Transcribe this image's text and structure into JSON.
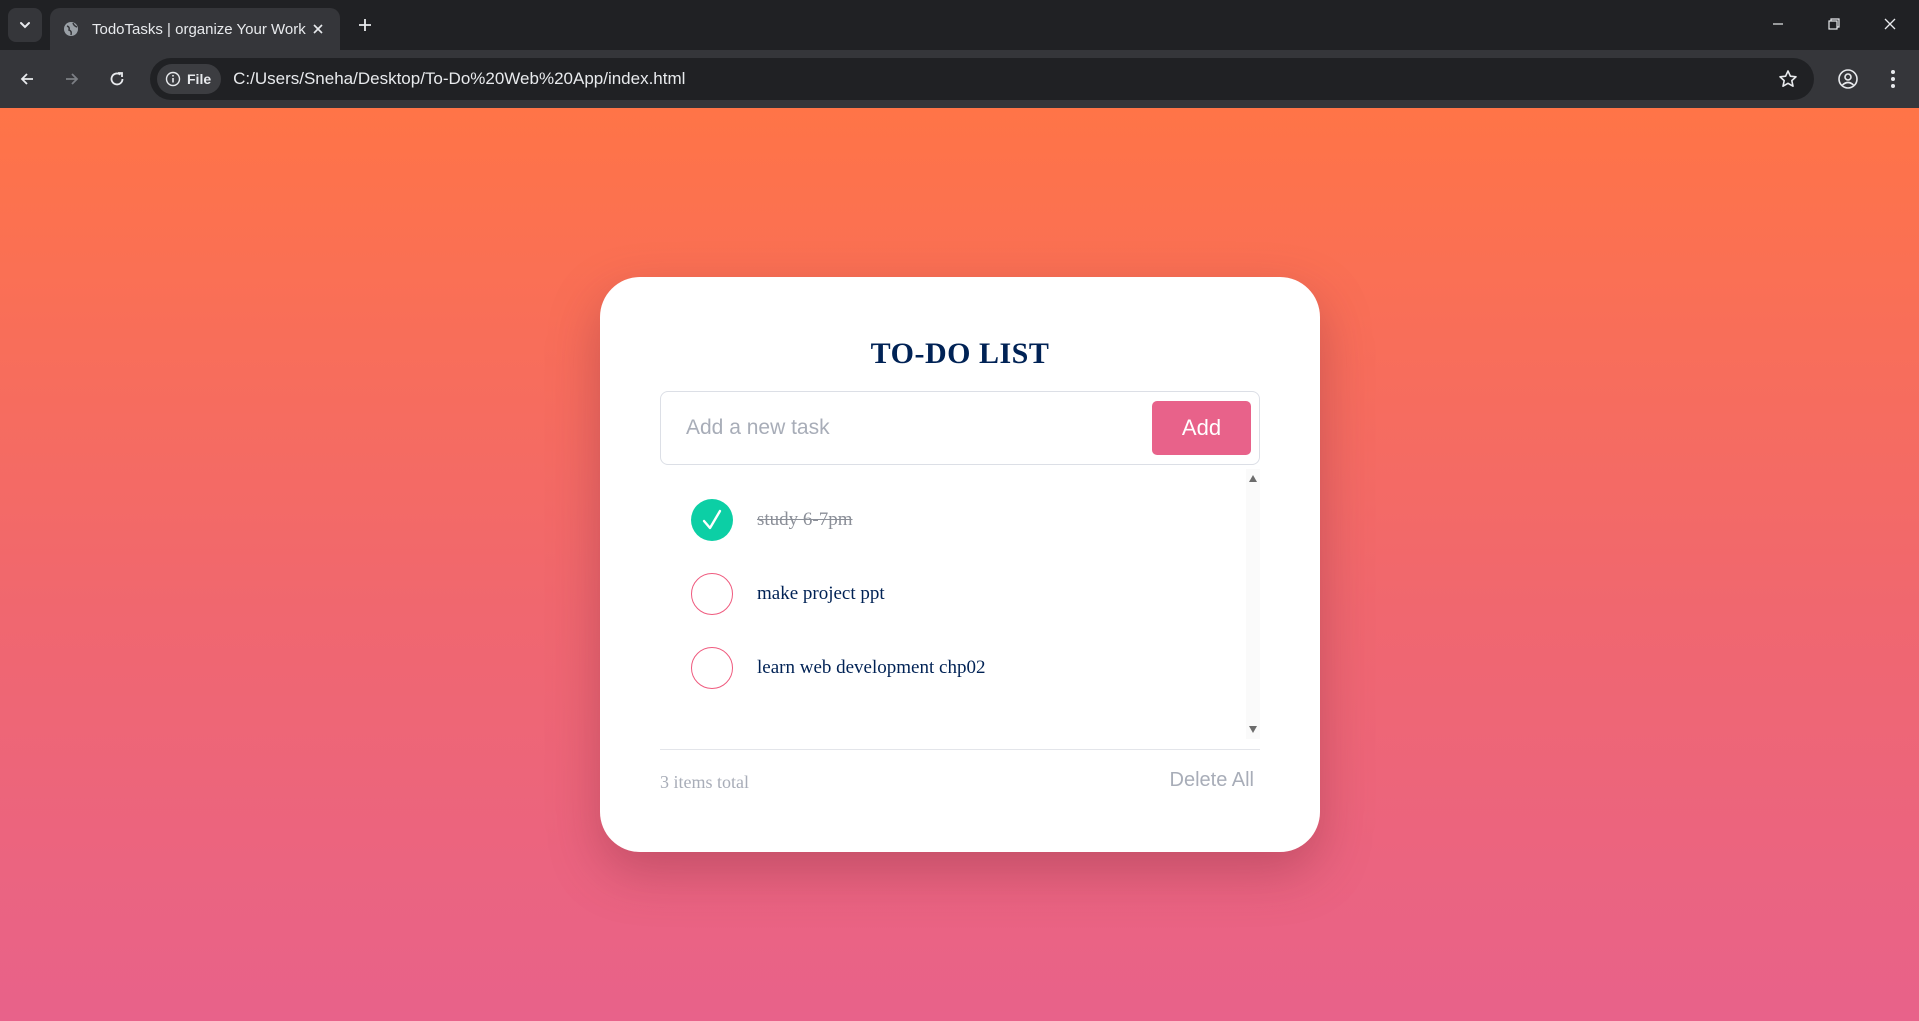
{
  "browser": {
    "tab_title": "TodoTasks | organize Your Work",
    "address_chip": "File",
    "url": "C:/Users/Sneha/Desktop/To-Do%20Web%20App/index.html"
  },
  "app": {
    "heading": "TO-DO LIST",
    "input_placeholder": "Add a new task",
    "add_label": "Add",
    "tasks": [
      {
        "text": "study 6-7pm",
        "completed": true
      },
      {
        "text": "make project ppt",
        "completed": false
      },
      {
        "text": "learn web development chp02",
        "completed": false
      }
    ],
    "count_label": "3 items total",
    "delete_all_label": "Delete All"
  },
  "colors": {
    "accent_pink": "#e8628a",
    "check_green": "#0ccfa5",
    "heading_navy": "#002255",
    "gradient_top": "#ff7447",
    "gradient_bottom": "#e8628a"
  },
  "icons": [
    "tab-list-icon",
    "globe-icon",
    "close-icon",
    "plus-icon",
    "minimize-icon",
    "restore-icon",
    "back-icon",
    "forward-icon",
    "reload-icon",
    "info-icon",
    "star-icon",
    "profile-icon",
    "kebab-menu-icon",
    "checkmark-icon"
  ]
}
